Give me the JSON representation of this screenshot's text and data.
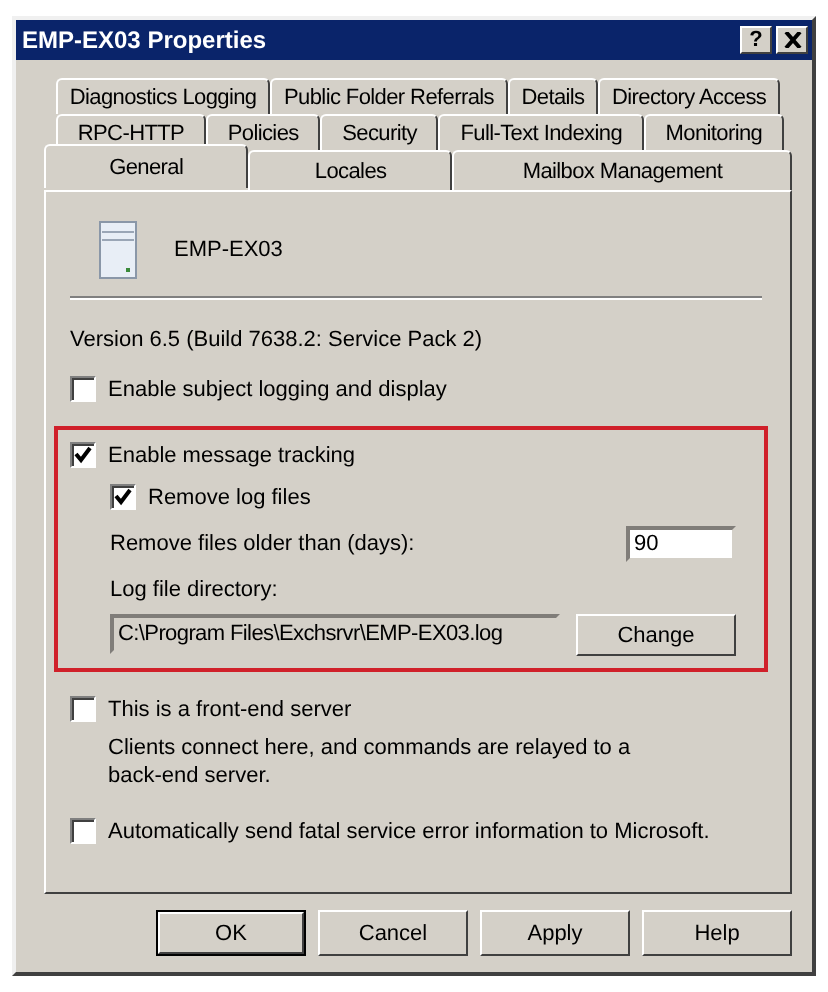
{
  "window": {
    "title": "EMP-EX03 Properties",
    "help": "?"
  },
  "tab_rows": [
    [
      {
        "label": "Diagnostics Logging",
        "selected": false
      },
      {
        "label": "Public Folder Referrals",
        "selected": false
      },
      {
        "label": "Details",
        "selected": false
      },
      {
        "label": "Directory Access",
        "selected": false
      }
    ],
    [
      {
        "label": "RPC-HTTP",
        "selected": false
      },
      {
        "label": "Policies",
        "selected": false
      },
      {
        "label": "Security",
        "selected": false
      },
      {
        "label": "Full-Text Indexing",
        "selected": false
      },
      {
        "label": "Monitoring",
        "selected": false
      }
    ],
    [
      {
        "label": "General",
        "selected": true
      },
      {
        "label": "Locales",
        "selected": false
      },
      {
        "label": "Mailbox Management",
        "selected": false
      }
    ]
  ],
  "server": {
    "name": "EMP-EX03"
  },
  "version": "Version 6.5 (Build 7638.2: Service Pack 2)",
  "subject_logging": {
    "label": "Enable subject logging and display",
    "checked": false
  },
  "tracking": {
    "label": "Enable message tracking",
    "checked": true,
    "remove_logs": {
      "label": "Remove log files",
      "checked": true
    },
    "age": {
      "label": "Remove files older than (days):",
      "value": "90"
    },
    "directory": {
      "label": "Log file directory:",
      "value": "C:\\Program Files\\Exchsrvr\\EMP-EX03.log",
      "button": "Change"
    }
  },
  "front_end": {
    "label": "This is a front-end server",
    "checked": false,
    "description": "Clients connect here, and commands are relayed to a back-end server."
  },
  "error_reporting": {
    "label": "Automatically send fatal service error information to Microsoft.",
    "checked": false
  },
  "buttons": [
    {
      "label": "OK",
      "default": true
    },
    {
      "label": "Cancel",
      "default": false
    },
    {
      "label": "Apply",
      "default": false
    },
    {
      "label": "Help",
      "default": false
    }
  ]
}
